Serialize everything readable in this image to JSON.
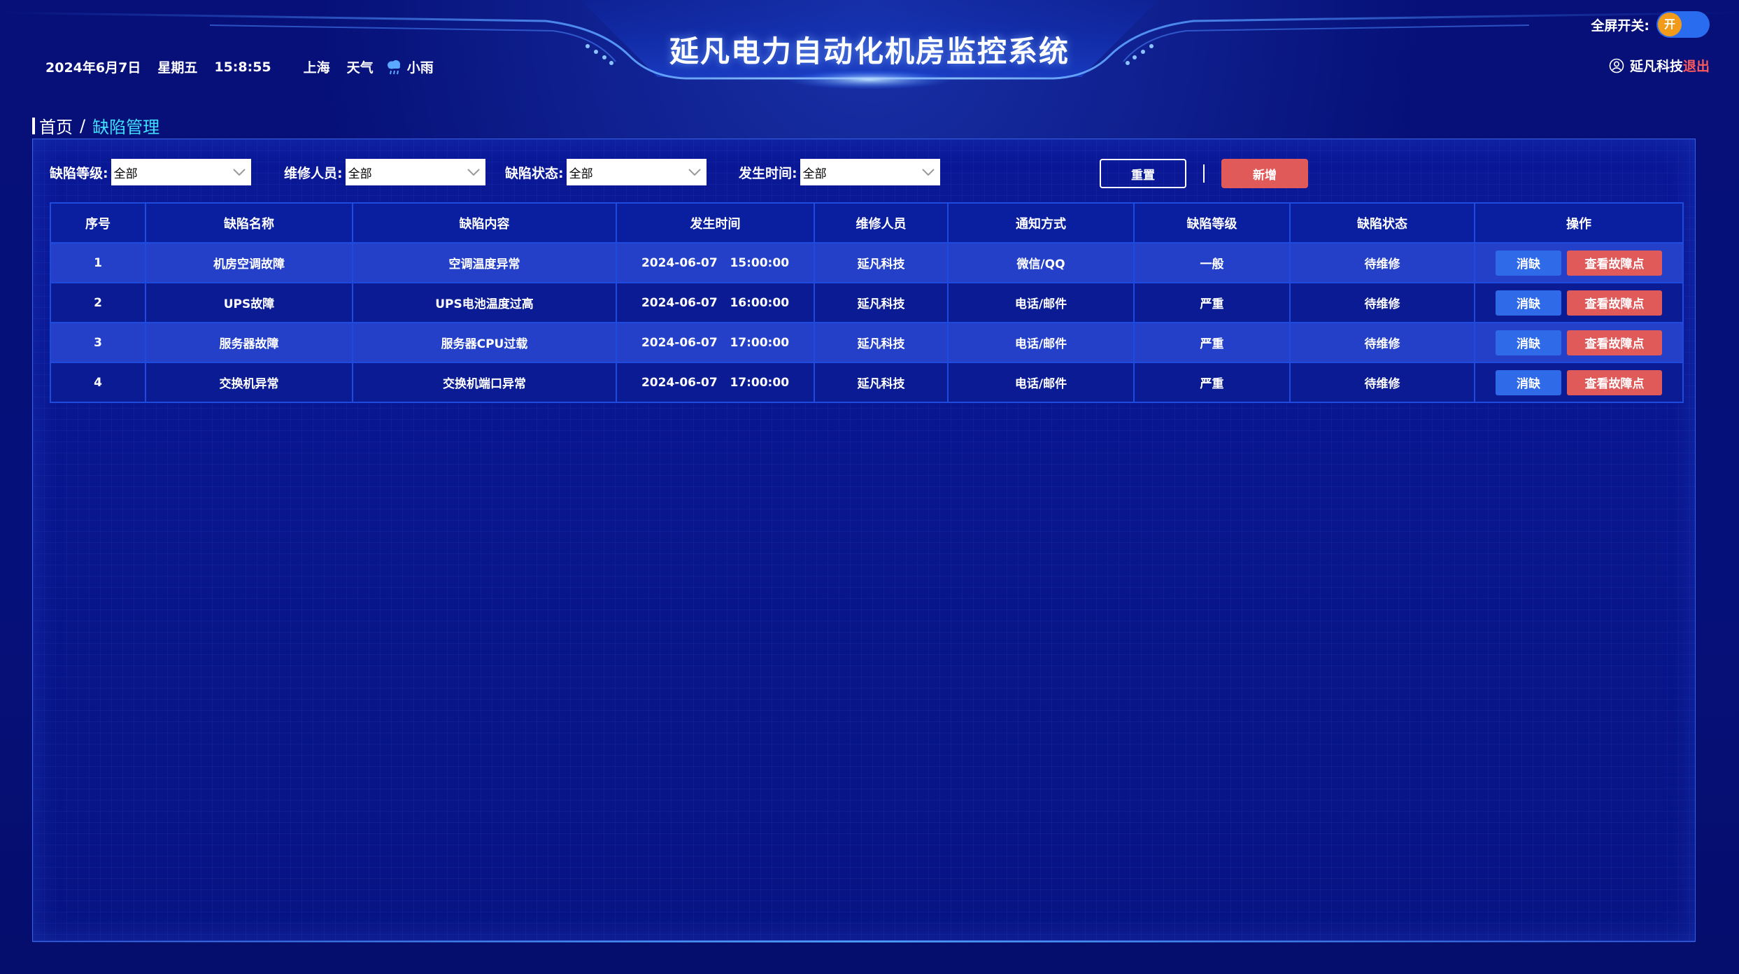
{
  "header": {
    "title": "延凡电力自动化机房监控系统",
    "date": "2024年6月7日",
    "weekday": "星期五",
    "time": "15:8:55",
    "city": "上海",
    "weather_label": "天气",
    "weather": "小雨",
    "weather_icon": "rain-cloud-icon",
    "fullscreen_label": "全屏开关:",
    "fullscreen_toggle": "开",
    "user_name": "延凡科技",
    "logout": "退出"
  },
  "breadcrumb": {
    "home": "首页",
    "separator": "/",
    "current": "缺陷管理"
  },
  "filters": {
    "level_label": "缺陷等级:",
    "level_value": "全部",
    "staff_label": "维修人员:",
    "staff_value": "全部",
    "status_label": "缺陷状态:",
    "status_value": "全部",
    "time_label": "发生时间:",
    "time_value": "全部",
    "reset": "重置",
    "add": "新增"
  },
  "table": {
    "headers": [
      "序号",
      "缺陷名称",
      "缺陷内容",
      "发生时间",
      "维修人员",
      "通知方式",
      "缺陷等级",
      "缺陷状态",
      "操作"
    ],
    "rows": [
      [
        "1",
        "机房空调故障",
        "空调温度异常",
        "2024-06-07   15:00:00",
        "延凡科技",
        "微信/QQ",
        "一般",
        "待维修"
      ],
      [
        "2",
        "UPS故障",
        "UPS电池温度过高",
        "2024-06-07   16:00:00",
        "延凡科技",
        "电话/邮件",
        "严重",
        "待维修"
      ],
      [
        "3",
        "服务器故障",
        "服务器CPU过载",
        "2024-06-07   17:00:00",
        "延凡科技",
        "电话/邮件",
        "严重",
        "待维修"
      ],
      [
        "4",
        "交换机异常",
        "交换机端口异常",
        "2024-06-07   17:00:00",
        "延凡科技",
        "电话/邮件",
        "严重",
        "待维修"
      ]
    ],
    "op_clear": "消缺",
    "op_view": "查看故障点"
  },
  "colors": {
    "background": "#05106a",
    "accent_cyan": "#3fe0ff",
    "danger": "#e05a5a",
    "primary": "#2f6ae8",
    "toggle_knob": "#f29b1b"
  }
}
